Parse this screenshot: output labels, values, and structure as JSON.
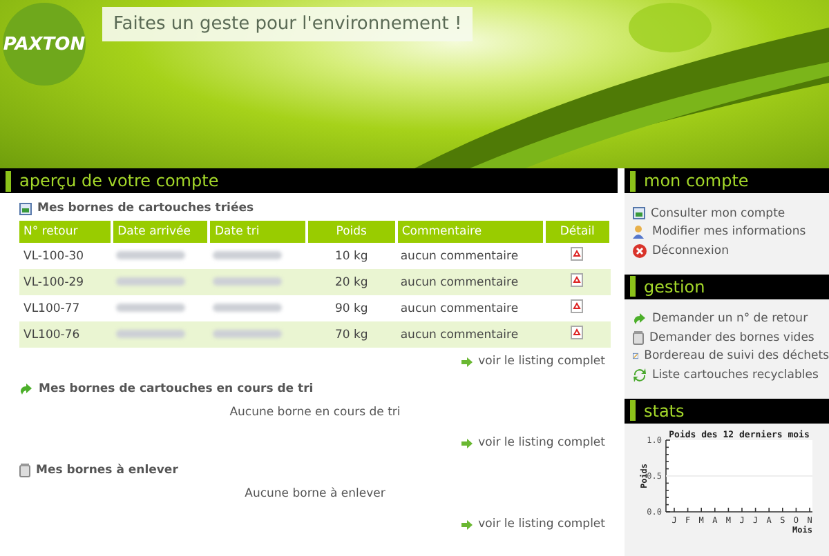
{
  "header": {
    "logo": "PAXTON",
    "slogan": "Faites un geste pour l'environnement !"
  },
  "main": {
    "title": "aperçu de votre compte",
    "sections": [
      {
        "kind": "table",
        "heading": "Mes bornes de cartouches triées",
        "columns": [
          "N° retour",
          "Date arrivée",
          "Date tri",
          "Poids",
          "Commentaire",
          "Détail"
        ],
        "rows": [
          {
            "id": "VL-100-30",
            "weight": "10 kg",
            "comment": "aucun commentaire"
          },
          {
            "id": "VL-100-29",
            "weight": "20 kg",
            "comment": "aucun commentaire"
          },
          {
            "id": "VL100-77",
            "weight": "90 kg",
            "comment": "aucun commentaire"
          },
          {
            "id": "VL100-76",
            "weight": "70 kg",
            "comment": "aucun commentaire"
          }
        ],
        "link": "voir le listing complet"
      },
      {
        "kind": "empty",
        "heading": "Mes bornes de cartouches en cours de tri",
        "message": "Aucune borne en cours de tri",
        "link": "voir le listing complet"
      },
      {
        "kind": "empty",
        "heading": "Mes bornes à enlever",
        "message": "Aucune borne à enlever",
        "link": "voir le listing complet"
      }
    ]
  },
  "sidebar": [
    {
      "title": "mon compte",
      "links": [
        "Consulter mon compte",
        "Modifier mes informations",
        "Déconnexion"
      ]
    },
    {
      "title": "gestion",
      "links": [
        "Demander un n° de retour",
        "Demander des bornes vides",
        "Bordereau de suivi des déchets",
        "Liste cartouches recyclables"
      ]
    },
    {
      "title": "stats",
      "chart_data": {
        "type": "line",
        "title": "Poids des 12 derniers mois",
        "xlabel": "Mois",
        "ylabel": "Poids",
        "categories": [
          "J",
          "F",
          "M",
          "A",
          "M",
          "J",
          "J",
          "A",
          "S",
          "O",
          "N"
        ],
        "ylim": [
          0,
          1
        ],
        "yticks": [
          {
            "value": 0,
            "label": "0.0"
          },
          {
            "value": 0.5,
            "label": "0.5"
          },
          {
            "value": 1,
            "label": "1.0"
          }
        ]
      }
    }
  ]
}
